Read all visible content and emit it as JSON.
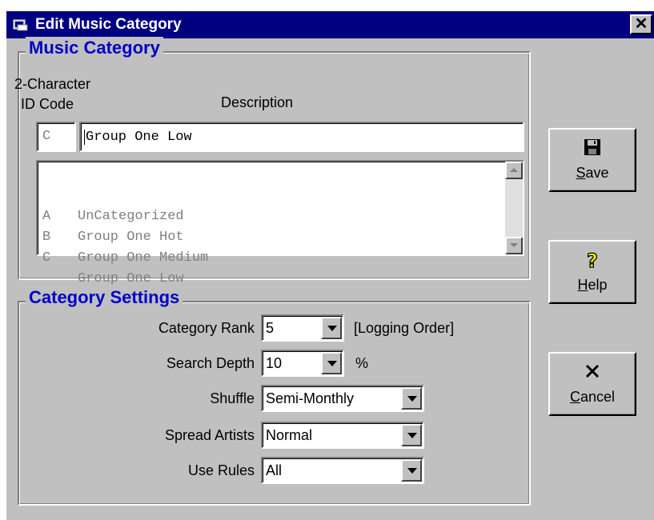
{
  "window": {
    "title": "Edit Music Category",
    "close_label": "✕"
  },
  "music_category": {
    "group_title": "Music Category",
    "id_label_line1": "2-Character",
    "id_label_line2": "ID Code",
    "description_label": "Description",
    "id_value": "C",
    "description_value": "Group One Low",
    "list_items": [
      {
        "code": "",
        "description": "UnCategorized"
      },
      {
        "code": "A",
        "description": "Group One Hot"
      },
      {
        "code": "B",
        "description": "Group One Medium"
      },
      {
        "code": "C",
        "description": "Group One Low"
      }
    ]
  },
  "category_settings": {
    "group_title": "Category Settings",
    "rank_label": "Category Rank",
    "rank_value": "5",
    "rank_note": "[Logging Order]",
    "search_depth_label": "Search Depth",
    "search_depth_value": "10",
    "search_depth_unit": "%",
    "shuffle_label": "Shuffle",
    "shuffle_value": "Semi-Monthly",
    "spread_artists_label": "Spread Artists",
    "spread_artists_value": "Normal",
    "use_rules_label": "Use Rules",
    "use_rules_value": "All"
  },
  "buttons": {
    "save": {
      "first": "S",
      "rest": "ave",
      "icon": "floppy-disk-icon"
    },
    "help": {
      "first": "H",
      "rest": "elp",
      "icon": "question-mark-icon"
    },
    "cancel": {
      "first": "C",
      "rest": "ancel",
      "icon": "x-icon"
    }
  },
  "colors": {
    "title_bar": "#000080",
    "group_title": "#0000c8",
    "face": "#c0c0c0"
  }
}
